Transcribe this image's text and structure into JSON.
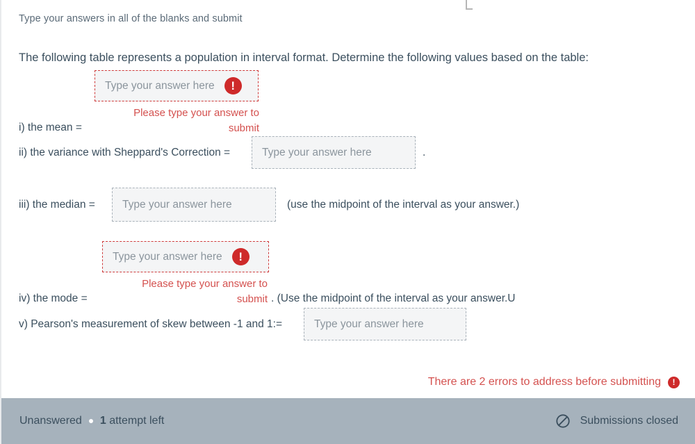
{
  "intro": "Type your answers in all of the blanks and submit",
  "prompt": "The following table represents a population in interval format.  Determine the following values based on the table:",
  "placeholder": "Type your answer here",
  "error_text": "Please type your answer to submit",
  "questions": {
    "i": "i) the mean =",
    "ii": "ii) the variance with Sheppard's Correction =",
    "ii_suffix": ".",
    "iii": "iii)  the median =",
    "iii_suffix": "(use the midpoint of the interval as your answer.)",
    "iv": "iv)  the mode =",
    "iv_suffix": ". (Use the midpoint of the interval as your answer.U",
    "v": "v)  Pearson's measurement of skew between -1 and 1:="
  },
  "blanks": {
    "mean": {
      "value": "",
      "has_error": true
    },
    "variance": {
      "value": "",
      "has_error": false
    },
    "median": {
      "value": "",
      "has_error": false
    },
    "mode": {
      "value": "",
      "has_error": true
    },
    "skew": {
      "value": "",
      "has_error": false
    }
  },
  "summary": {
    "errors_text": "There are 2 errors to address before submitting",
    "error_icon": "exclamation-circle-icon"
  },
  "footer": {
    "status": "Unanswered",
    "attempts_count": "1",
    "attempts_suffix": "attempt left",
    "submissions_text": "Submissions closed",
    "submissions_icon": "ban-icon"
  },
  "colors": {
    "error_red": "#ce2a2a",
    "error_text_red": "#d4514f",
    "footer_bg": "#a6b2bc",
    "text": "#3b4f5e",
    "placeholder": "#8b959d",
    "blank_bg": "#f4f5f6",
    "blank_border": "#a9b2ba"
  }
}
